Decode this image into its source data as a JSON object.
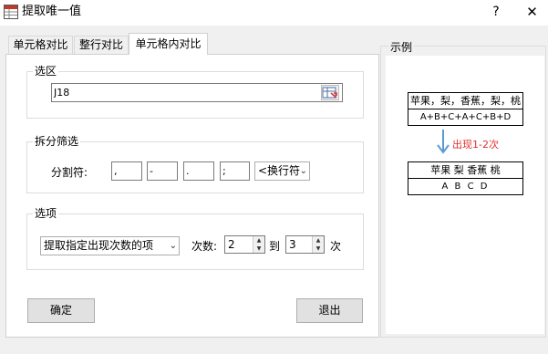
{
  "window": {
    "title": "提取唯一值",
    "help": "?",
    "close": "✕"
  },
  "tabs": [
    {
      "label": "单元格对比"
    },
    {
      "label": "整行对比"
    },
    {
      "label": "单元格内对比"
    }
  ],
  "selection": {
    "legend": "选区",
    "value": "J18"
  },
  "split": {
    "legend": "拆分筛选",
    "label": "分割符:",
    "delimiters": [
      ",",
      "-",
      ".",
      ";"
    ],
    "combo": "<换行符"
  },
  "options": {
    "legend": "选项",
    "mode": "提取指定出现次数的项",
    "count_label": "次数:",
    "from": "2",
    "to_label": "到",
    "to": "3",
    "times_label": "次"
  },
  "buttons": {
    "ok": "确定",
    "exit": "退出"
  },
  "example": {
    "legend": "示例",
    "input_row1": "苹果，梨，香蕉，梨，桃",
    "input_row2": "A+B+C+A+C+B+D",
    "arrow_label": "出现1-2次",
    "output_row1": "苹果 梨 香蕉 桃",
    "output_row2": "A B C D",
    "colors": {
      "arrow": "#5b9bd5",
      "arrow_label": "#e03030"
    }
  }
}
